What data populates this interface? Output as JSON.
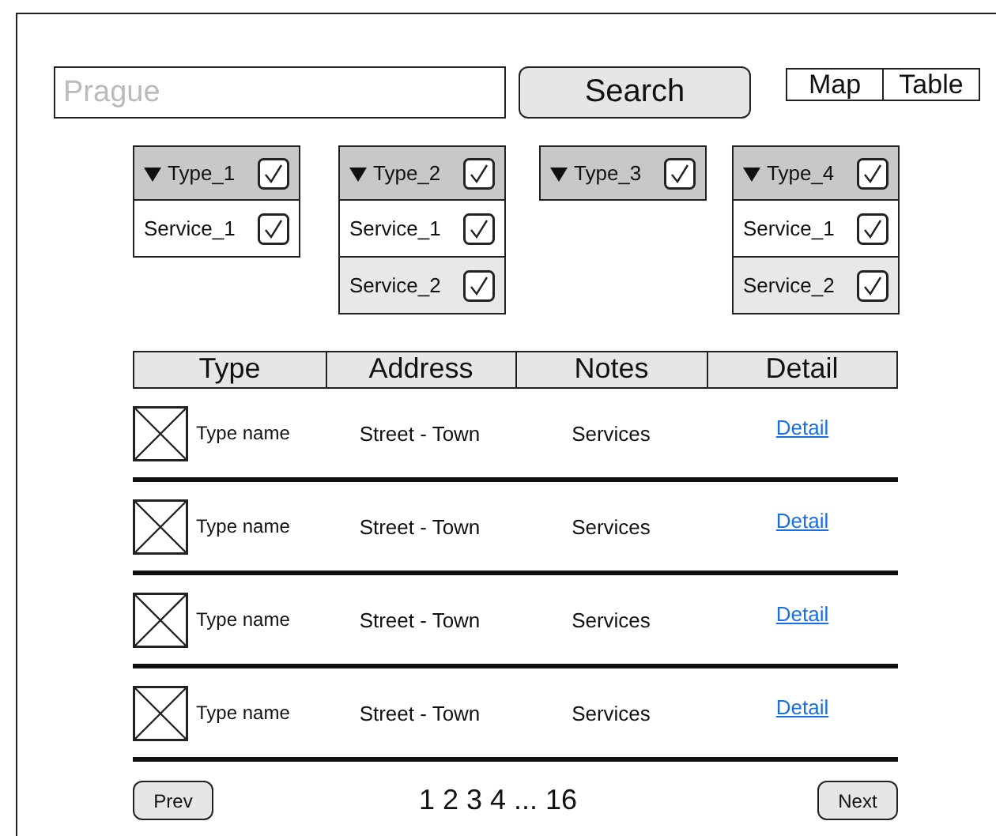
{
  "search": {
    "placeholder": "Prague",
    "button": "Search"
  },
  "view_toggle": [
    {
      "label": "Map"
    },
    {
      "label": "Table"
    }
  ],
  "filters": [
    {
      "label": "Type_1",
      "checked": true,
      "expanded": true,
      "children": [
        {
          "label": "Service_1",
          "checked": true
        }
      ]
    },
    {
      "label": "Type_2",
      "checked": true,
      "expanded": true,
      "children": [
        {
          "label": "Service_1",
          "checked": true
        },
        {
          "label": "Service_2",
          "checked": true
        }
      ]
    },
    {
      "label": "Type_3",
      "checked": true,
      "expanded": true
    },
    {
      "label": "Type_4",
      "checked": true,
      "expanded": true,
      "children": [
        {
          "label": "Service_1",
          "checked": true
        },
        {
          "label": "Service_2",
          "checked": true
        }
      ]
    }
  ],
  "table": {
    "columns": [
      "Type",
      "Address",
      "Notes",
      "Detail"
    ],
    "rows": [
      {
        "type": "Type name",
        "address": "Street - Town",
        "notes": "Services",
        "detail": "Detail"
      },
      {
        "type": "Type name",
        "address": "Street - Town",
        "notes": "Services",
        "detail": "Detail"
      },
      {
        "type": "Type name",
        "address": "Street - Town",
        "notes": "Services",
        "detail": "Detail"
      },
      {
        "type": "Type name",
        "address": "Street - Town",
        "notes": "Services",
        "detail": "Detail"
      }
    ]
  },
  "pagination": {
    "prev": "Prev",
    "pages": "1 2 3 4 ... 16",
    "next": "Next"
  }
}
